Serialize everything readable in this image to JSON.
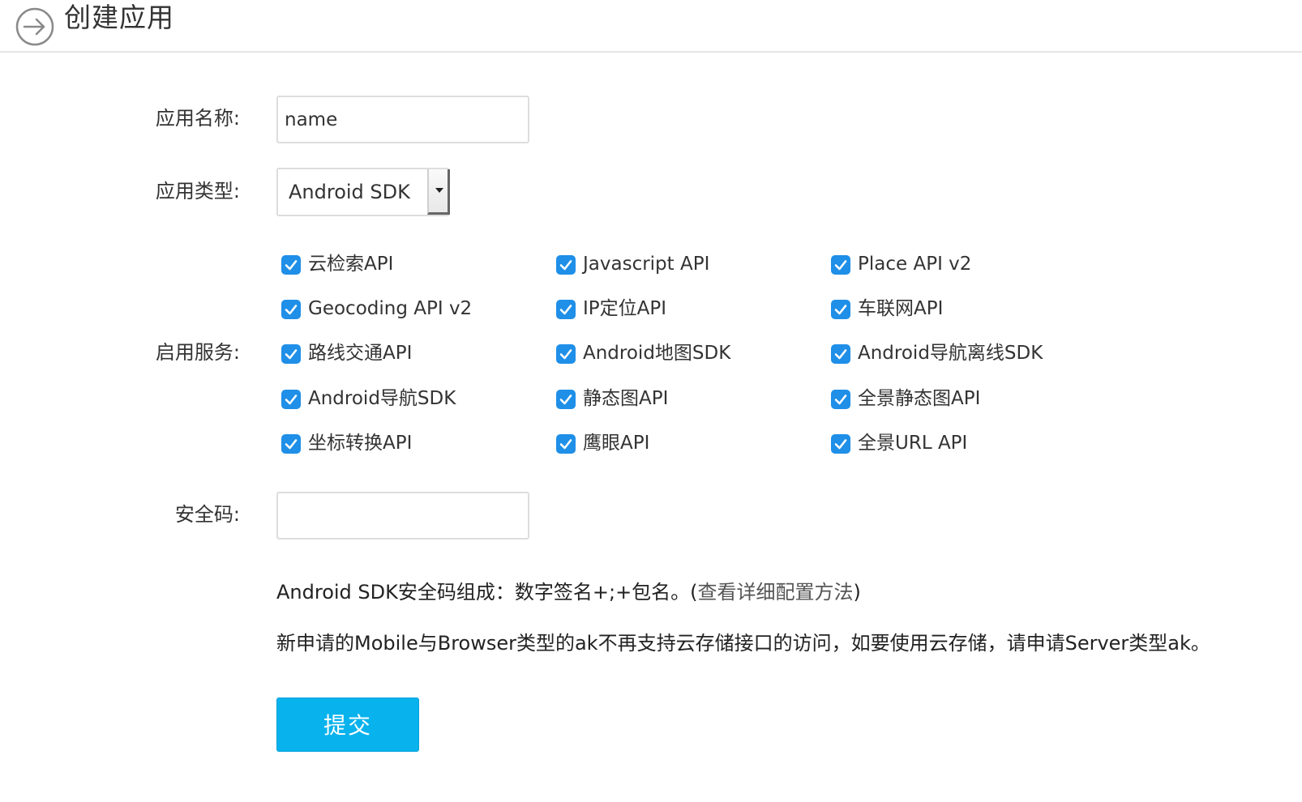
{
  "header": {
    "title": "创建应用",
    "icon": "arrow-right-circle-icon"
  },
  "form": {
    "app_name": {
      "label": "应用名称:",
      "value": "name"
    },
    "app_type": {
      "label": "应用类型:",
      "selected": "Android SDK"
    },
    "services": {
      "label": "启用服务:",
      "checkbox_color": "#1f8fe8",
      "items": [
        {
          "label": "云检索API",
          "checked": true
        },
        {
          "label": "Javascript API",
          "checked": true
        },
        {
          "label": "Place API v2",
          "checked": true
        },
        {
          "label": "Geocoding API v2",
          "checked": true
        },
        {
          "label": "IP定位API",
          "checked": true
        },
        {
          "label": "车联网API",
          "checked": true
        },
        {
          "label": "路线交通API",
          "checked": true
        },
        {
          "label": "Android地图SDK",
          "checked": true
        },
        {
          "label": "Android导航离线SDK",
          "checked": true
        },
        {
          "label": "Android导航SDK",
          "checked": true
        },
        {
          "label": "静态图API",
          "checked": true
        },
        {
          "label": "全景静态图API",
          "checked": true
        },
        {
          "label": "坐标转换API",
          "checked": true
        },
        {
          "label": "鹰眼API",
          "checked": true
        },
        {
          "label": "全景URL API",
          "checked": true
        }
      ]
    },
    "security_code": {
      "label": "安全码:",
      "value": ""
    },
    "notes": {
      "security_hint_prefix": "Android SDK安全码组成：数字签名+;+包名。(",
      "security_hint_link": "查看详细配置方法",
      "security_hint_suffix": ")",
      "storage_notice": "新申请的Mobile与Browser类型的ak不再支持云存储接口的访问，如要使用云存储，请申请Server类型ak。"
    },
    "submit_label": "提交",
    "submit_color": "#07b2ed"
  }
}
